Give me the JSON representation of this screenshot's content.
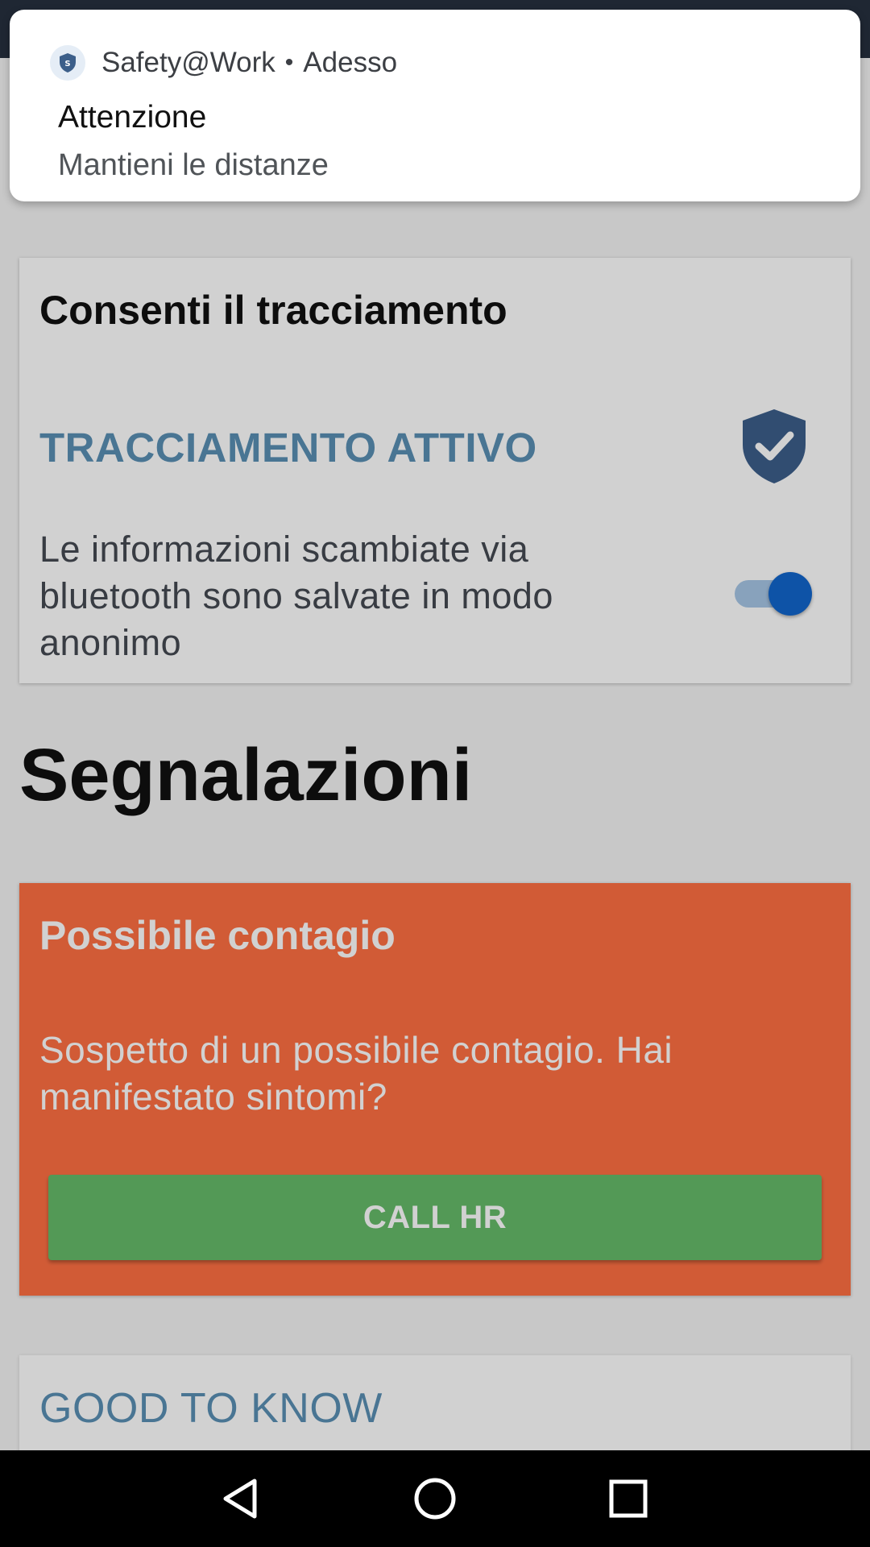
{
  "notification": {
    "app_name": "Safety@Work",
    "separator": "•",
    "time": "Adesso",
    "title": "Attenzione",
    "text": "Mantieni le distanze",
    "icon": "shield-icon"
  },
  "tracking_card": {
    "title": "Consenti il tracciamento",
    "status": "TRACCIAMENTO ATTIVO",
    "status_icon": "shield-check-icon",
    "description": "Le informazioni scambiate via bluetooth sono salvate in modo anonimo",
    "toggle_on": true
  },
  "reports": {
    "title": "Segnalazioni"
  },
  "alert_card": {
    "title": "Possibile contagio",
    "text": "Sospetto di un possibile contagio. Hai manifestato sintomi?",
    "button_label": "CALL HR"
  },
  "info_card": {
    "title": "GOOD TO KNOW"
  },
  "navbar": {
    "back_icon": "back-triangle-icon",
    "home_icon": "home-circle-icon",
    "recents_icon": "recents-square-icon"
  },
  "colors": {
    "alert_background": "#ff7043",
    "button_green": "#66bb6a",
    "accent_blue": "#5a8fb4",
    "toggle_blue": "#1266cc"
  }
}
